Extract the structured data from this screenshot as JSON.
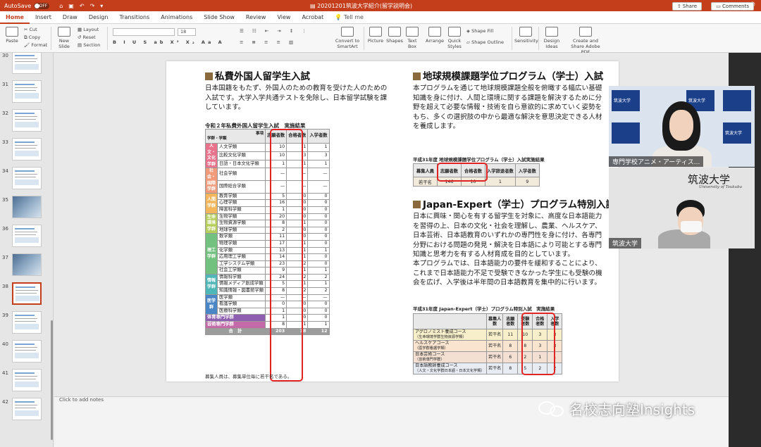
{
  "titlebar": {
    "autosave": "AutoSave",
    "autosave_state": "OFF",
    "title": "20201201筑波大学紹介(留学説明会)"
  },
  "tabs": [
    "Home",
    "Insert",
    "Draw",
    "Design",
    "Transitions",
    "Animations",
    "Slide Show",
    "Review",
    "View",
    "Acrobat"
  ],
  "tab_search": "Tell me",
  "share_label": "Share",
  "comments_label": "Comments",
  "ribbon": {
    "paste": "Paste",
    "cut": "Cut",
    "copy": "Copy",
    "format": "Format",
    "new_slide": "New Slide",
    "layout": "Layout",
    "reset": "Reset",
    "section": "Section",
    "font_size": "18",
    "convert_smartart": "Convert to SmartArt",
    "picture": "Picture",
    "shapes": "Shapes",
    "text_box": "Text Box",
    "arrange": "Arrange",
    "quick_styles": "Quick Styles",
    "shape_fill": "Shape Fill",
    "shape_outline": "Shape Outline",
    "sensitivity": "Sensitivity",
    "design_ideas": "Design Ideas",
    "create_share_pdf": "Create and Share Adobe PDF"
  },
  "thumbnails": [
    {
      "num": "30",
      "type": "doc"
    },
    {
      "num": "31",
      "type": "doc"
    },
    {
      "num": "32",
      "type": "doc"
    },
    {
      "num": "33",
      "type": "doc"
    },
    {
      "num": "34",
      "type": "doc"
    },
    {
      "num": "35",
      "type": "photo"
    },
    {
      "num": "36",
      "type": "doc"
    },
    {
      "num": "37",
      "type": "photo"
    },
    {
      "num": "38",
      "type": "doc",
      "selected": true
    },
    {
      "num": "39",
      "type": "doc"
    },
    {
      "num": "40",
      "type": "doc"
    },
    {
      "num": "41",
      "type": "doc"
    },
    {
      "num": "42",
      "type": "doc"
    }
  ],
  "notes_placeholder": "Click to add notes",
  "slide": {
    "left": {
      "title": "私費外国人留学生入試",
      "para": "日本国籍をもたず、外国人のための教育を受けた人のための入試です。大学入学共通テストを免除し、日本留学試験を課しています。",
      "table_caption": "令和２年私費外国人留学生入試　実施結果",
      "header": {
        "corner_top": "事項",
        "corner_bottom": "学群・学類",
        "c1": "志願者数",
        "c2": "合格者数",
        "c3": "入学者数"
      },
      "groups": [
        {
          "name": "人文・文化学群",
          "color": "#e8718b",
          "rows": [
            [
              "人文学類",
              "10",
              "1",
              "1"
            ],
            [
              "比較文化学類",
              "10",
              "3",
              "3"
            ],
            [
              "日語・日本文化学類",
              "1",
              "1",
              "1"
            ]
          ]
        },
        {
          "name": "社会・国際学群",
          "color": "#f19b7a",
          "rows": [
            [
              "社会学類",
              "—",
              "—",
              "—"
            ],
            [
              "国際総合学類",
              "—",
              "—",
              "—"
            ]
          ]
        },
        {
          "name": "人間学群",
          "color": "#f3b65b",
          "rows": [
            [
              "教育学類",
              "5",
              "0",
              "0"
            ],
            [
              "心理学類",
              "16",
              "0",
              "0"
            ],
            [
              "障害科学類",
              "1",
              "0",
              "0"
            ]
          ]
        },
        {
          "name": "生命環境学群",
          "color": "#b6cf5b",
          "rows": [
            [
              "生物学類",
              "20",
              "0",
              "0"
            ],
            [
              "生物資源学類",
              "8",
              "1",
              "0"
            ],
            [
              "地球学類",
              "2",
              "0",
              "0"
            ]
          ]
        },
        {
          "name": "理工学群",
          "color": "#72c17e",
          "rows": [
            [
              "数学類",
              "11",
              "0",
              "0"
            ],
            [
              "物理学類",
              "17",
              "1",
              "0"
            ],
            [
              "化学類",
              "13",
              "1",
              "1"
            ],
            [
              "応用理工学類",
              "14",
              "1",
              "0"
            ],
            [
              "工学システム学類",
              "23",
              "2",
              "0"
            ],
            [
              "社会工学類",
              "9",
              "1",
              "1"
            ]
          ]
        },
        {
          "name": "情報学群",
          "color": "#4fb7b7",
          "rows": [
            [
              "情報科学類",
              "24",
              "2",
              "2"
            ],
            [
              "情報メディア創成学類",
              "5",
              "1",
              "1"
            ],
            [
              "知識情報・図書館学類",
              "8",
              "2",
              "2"
            ]
          ]
        },
        {
          "name": "医学群",
          "color": "#4a86c6",
          "rows": [
            [
              "医学類",
              "—",
              "—",
              "—"
            ],
            [
              "看護学類",
              "0",
              "0",
              "0"
            ],
            [
              "医療科学類",
              "1",
              "0",
              "0"
            ]
          ]
        }
      ],
      "extra_rows": [
        {
          "name": "体育専門学群",
          "color": "#8e5fb0",
          "values": [
            "1",
            "0",
            "0"
          ]
        },
        {
          "name": "芸術専門学群",
          "color": "#c46aa8",
          "values": [
            "8",
            "1",
            "1"
          ]
        }
      ],
      "total_label": "合　計",
      "total": [
        "203",
        "18",
        "12"
      ],
      "note": "募集人員は、募集単位毎に若干名である。"
    },
    "right_top": {
      "title": "地球規模課題学位プログラム（学士）入試",
      "para": "本プログラムを通じて地球規模課題全般を俯瞰する幅広い基礎知識を身に付け、人間と環境に関する課題を解決するために分野を超えて必要な情報・技術を自ら意欲的に求めていく姿勢をもち、多くの選択肢の中から最適な解決を意思決定できる人材を養成します。",
      "table_caption": "平成31年度 地球規模課題学位プログラム（学士）入試実施結果",
      "header": [
        "募集人員",
        "志願者数",
        "合格者数",
        "入学辞退者数",
        "入学者数"
      ],
      "row": [
        "若干名",
        "146",
        "10",
        "1",
        "9"
      ]
    },
    "right_bottom": {
      "title": "Japan-Expert（学士）プログラム特別入試",
      "para1": "日本に興味・関心を有する留学生を対象に、高度な日本語能力を習得の上、日本の文化・社会を理解し、農業、ヘルスケア、日本芸術、日本語教育のいずれかの専門性を身に付け、各専門分野における問題の発見・解決を日本語により可能とする専門知識と思考力を有する人材育成を目的としています。",
      "para2": "本プログラムでは、日本語能力の要件を緩和することにより、これまで日本語能力不足で受験できなかった学生にも受験の機会を広げ、入学後は半年間の日本語教育を集中的に行います。",
      "table_caption": "平成31年度 Japan-Expert（学士）プログラム特別入試　実施結果",
      "header": [
        "募集人数",
        "志願者数",
        "受験者数",
        "合格者数",
        "入学者数"
      ],
      "rows": [
        {
          "course": "アグロノミスト養成コース",
          "sub": "（生命環境学群生物資源学類）",
          "values": [
            "若干名",
            "11",
            "10",
            "3",
            "3"
          ]
        },
        {
          "course": "ヘルスケアコース",
          "sub": "（医学群看護学類）",
          "values": [
            "若干名",
            "8",
            "8",
            "3",
            "3"
          ]
        },
        {
          "course": "日本芸術コース",
          "sub": "（芸術専門学群）",
          "values": [
            "若干名",
            "6",
            "2",
            "1",
            "1"
          ]
        },
        {
          "course": "日本語教師養成コース",
          "sub": "（人文・文化学群日本語・日本文化学類）",
          "values": [
            "若干名",
            "8",
            "5",
            "2",
            "2"
          ]
        }
      ]
    }
  },
  "video": {
    "p1_label": "専門学校アニメ・アーティス...",
    "p2_label": "筑波大学",
    "backdrop_text": "筑波大学",
    "logo": "筑波大学",
    "logo_sub": "University of Tsukuba"
  },
  "watermark": "名校志向塾Insights"
}
